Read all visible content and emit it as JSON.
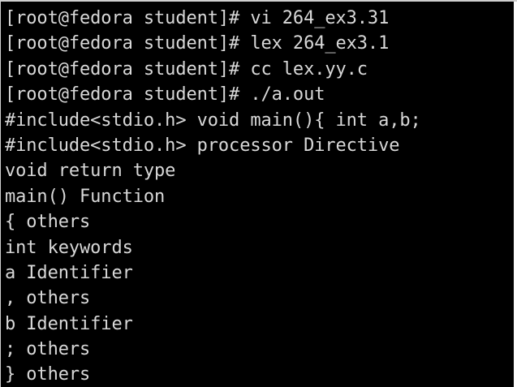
{
  "terminal": {
    "lines": [
      "[root@fedora student]# vi 264_ex3.31",
      "[root@fedora student]# lex 264_ex3.1",
      "[root@fedora student]# cc lex.yy.c",
      "[root@fedora student]# ./a.out",
      "#include<stdio.h> void main(){ int a,b;",
      "#include<stdio.h> processor Directive",
      "void return type",
      "main() Function",
      "{ others",
      "int keywords",
      "a Identifier",
      ", others",
      "b Identifier",
      "; others",
      "} others"
    ]
  },
  "colors": {
    "background": "#000000",
    "text": "#d8d8d8"
  }
}
